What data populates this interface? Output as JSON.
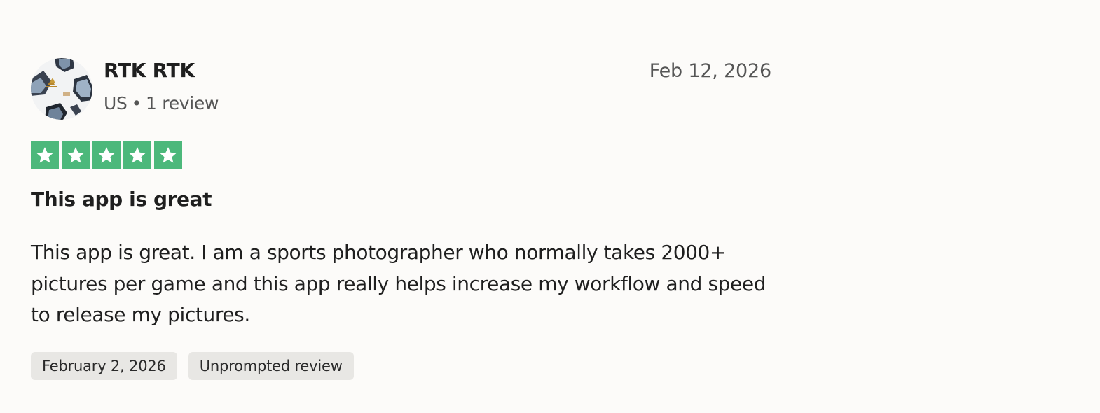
{
  "review": {
    "author": {
      "name": "RTK RTK",
      "country": "US",
      "separator": "•",
      "review_count": "1 review",
      "avatar_icon": "soccer-ball-avatar"
    },
    "published_date": "Feb 12, 2026",
    "rating": 5,
    "rating_max": 5,
    "star_color": "#4cb87b",
    "title": "This app is great",
    "text": "This app is great. I am a sports photographer who normally takes 2000+ pictures per game and this app really helps increase my workflow and speed to release my pictures.",
    "tags": {
      "experience_date": "February 2, 2026",
      "review_type": "Unprompted review"
    }
  }
}
